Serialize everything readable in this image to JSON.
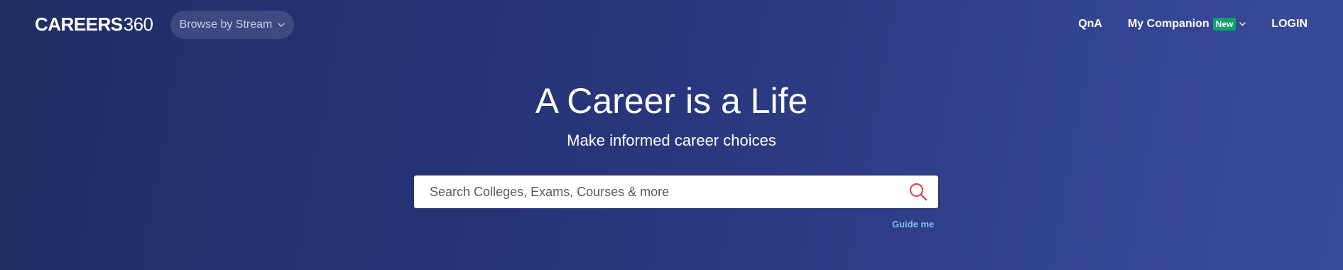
{
  "header": {
    "logo": {
      "main": "CAREERS",
      "number": "360"
    },
    "browse": {
      "label": "Browse by Stream",
      "icon": "chevron-down-icon"
    },
    "nav": {
      "qna": "QnA",
      "companion": "My Companion",
      "companion_badge": "New",
      "login": "LOGIN"
    }
  },
  "hero": {
    "title": "A Career is a Life",
    "subtitle": "Make informed career choices"
  },
  "search": {
    "placeholder": "Search Colleges, Exams, Courses & more",
    "icon": "search-icon",
    "guide_link": "Guide me"
  },
  "colors": {
    "background": "#27357a",
    "badge": "#0fa36b",
    "search_icon": "#e0484f",
    "guide_link": "#7fc2ec"
  }
}
